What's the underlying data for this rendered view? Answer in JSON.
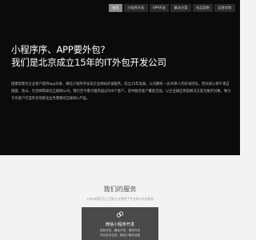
{
  "nav": {
    "items": [
      "首页",
      "小程序开发",
      "APP开发",
      "解决方案",
      "作品案例",
      "运营学院"
    ]
  },
  "hero": {
    "title_line1": "小程序序、APP要外包?",
    "title_line2": "我们是北京成立15年的IT外包开发公司",
    "description": "团建智策为企业客户提供app开发、微信小程序开发及企业网站开发服务。成立15年发展，公司拥有一支40余人的开发团队，团队核心骨干来自搜狐、金山、百合网等知名互联网公司，我们至今累计服务超过500个客户，其中服务客户覆盖全国，以企业级应用及解决方案为服务对象，致力于为客户打造符合场景化业务需要的互联网+产品。"
  },
  "services": {
    "title": "我们的服务",
    "subtitle": "15年来我们为上百家企业提供了专业的IT外包服务",
    "card": {
      "title": "微信小程序开发",
      "line1": "定制开发、模板开发、源码开发",
      "line2": "专业技术支持、微信小程序运营"
    }
  },
  "colors": {
    "hero_bg": "#0b0b0b",
    "card_bg": "#4a4a4a",
    "page_bg": "#f3f3f3"
  }
}
